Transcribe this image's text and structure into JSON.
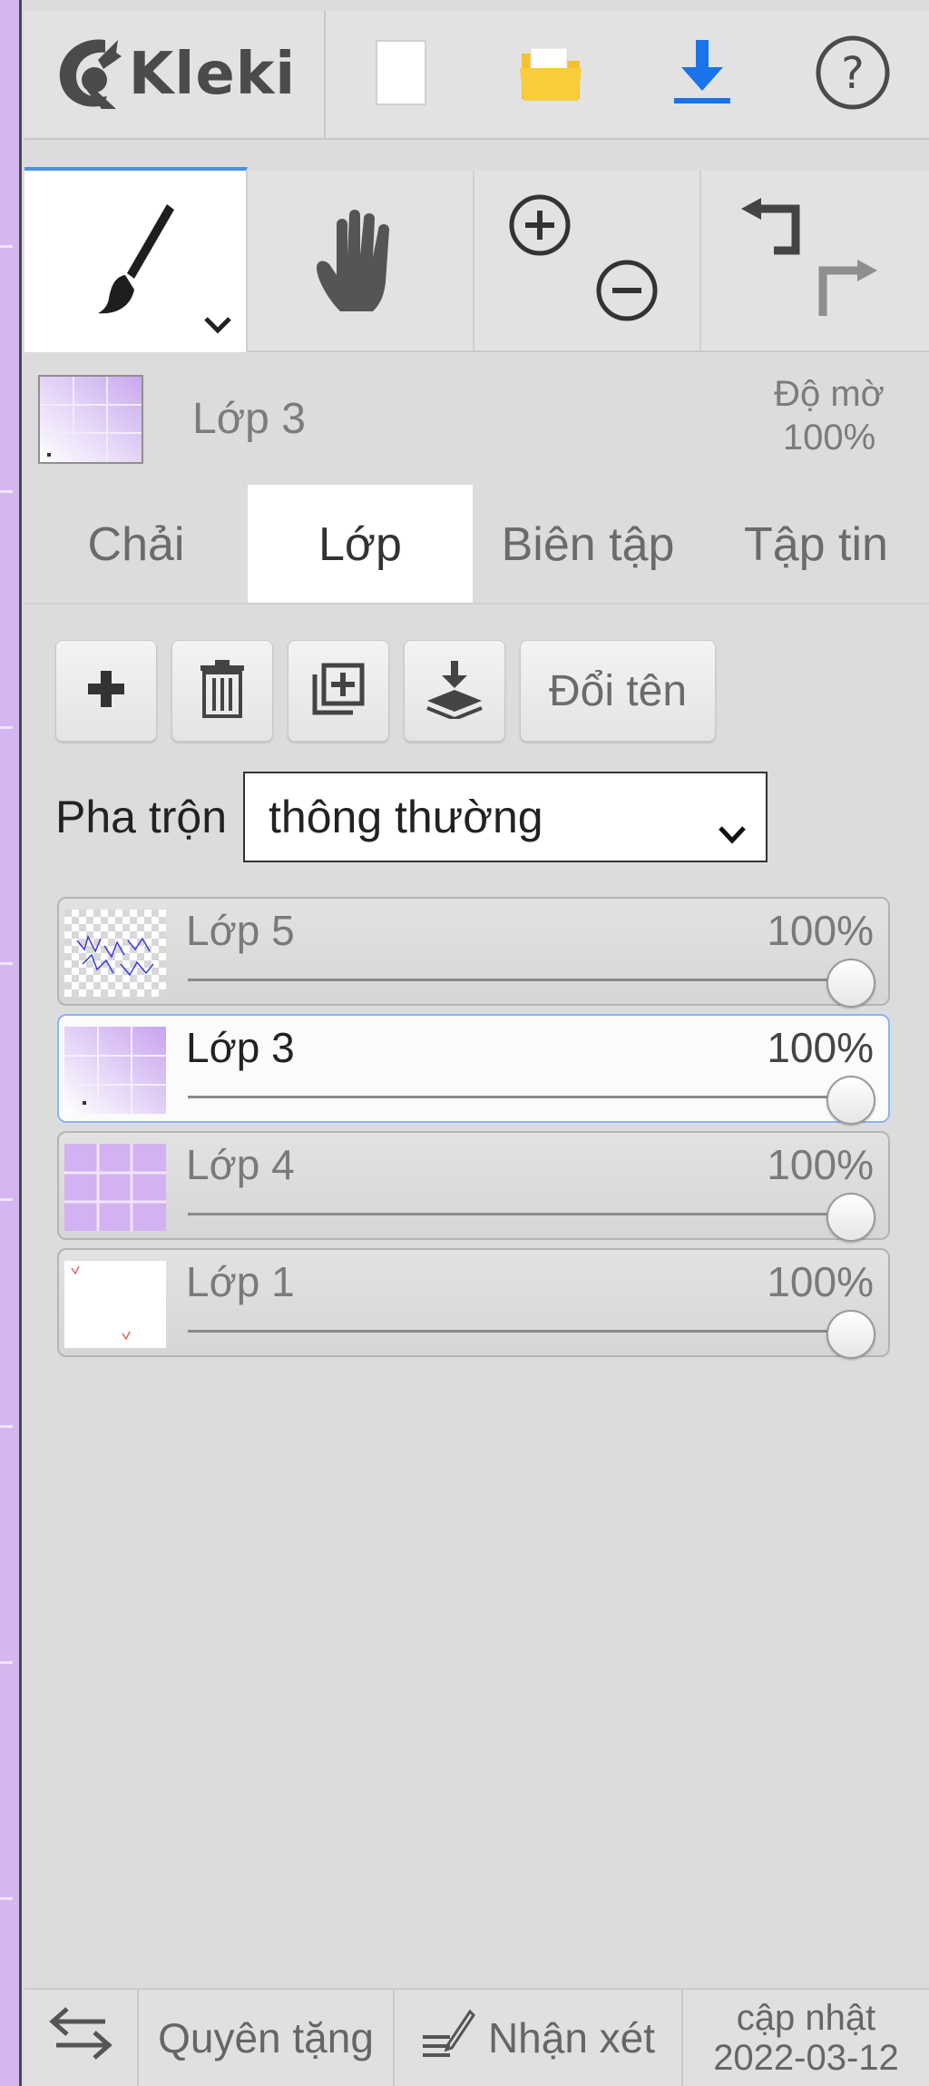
{
  "app": {
    "logo_text": "Kleki"
  },
  "topbar": {
    "buttons": [
      {
        "icon": "new-image-icon"
      },
      {
        "icon": "open-folder-icon",
        "color": "#f6c12e"
      },
      {
        "icon": "download-icon",
        "color": "#1a73e8"
      },
      {
        "icon": "help-icon"
      }
    ]
  },
  "tools": {
    "brush": "brush-icon",
    "hand": "hand-icon",
    "zoom": [
      "zoom-in-icon",
      "zoom-out-icon"
    ],
    "history": [
      "undo-icon",
      "redo-icon"
    ],
    "active_accent": "#4a90e2"
  },
  "current_layer": {
    "name": "Lớp 3",
    "opacity_label": "Độ mờ",
    "opacity_value": "100%"
  },
  "tabs": [
    {
      "label": "Chải",
      "active": false
    },
    {
      "label": "Lớp",
      "active": true
    },
    {
      "label": "Biên tập",
      "active": false
    },
    {
      "label": "Tập tin",
      "active": false
    }
  ],
  "layer_actions": {
    "add": "plus-icon",
    "delete": "trash-icon",
    "duplicate": "duplicate-icon",
    "merge": "merge-down-icon",
    "rename_label": "Đổi tên"
  },
  "blend": {
    "label": "Pha trộn",
    "value": "thông thường"
  },
  "layers": [
    {
      "name": "Lớp 5",
      "opacity": "100%",
      "selected": false
    },
    {
      "name": "Lớp 3",
      "opacity": "100%",
      "selected": true
    },
    {
      "name": "Lớp 4",
      "opacity": "100%",
      "selected": false
    },
    {
      "name": "Lớp 1",
      "opacity": "100%",
      "selected": false
    }
  ],
  "bottombar": {
    "swap_icon": "swap-arrows-icon",
    "donate_label": "Quyên tặng",
    "feedback_label": "Nhận xét",
    "feedback_icon": "feedback-pen-icon",
    "updated_label": "cập nhật",
    "updated_date": "2022-03-12"
  }
}
